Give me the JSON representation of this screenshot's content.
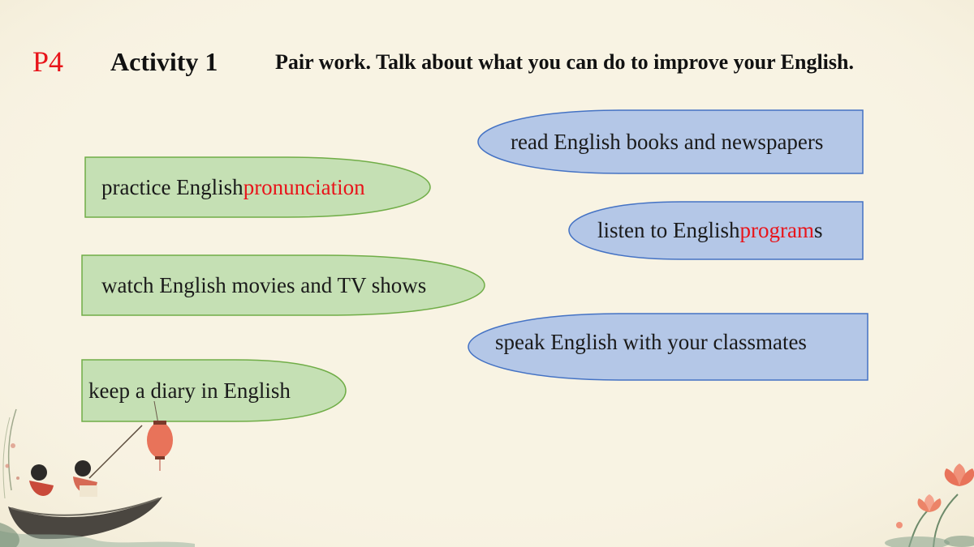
{
  "header": {
    "page_label": "P4",
    "activity_title": "Activity 1",
    "instruction": "Pair work. Talk about what you can do to improve your English."
  },
  "left_bubbles": [
    {
      "before": "practice English ",
      "highlight": "pronunciation",
      "after": ""
    },
    {
      "text": "watch English movies and TV shows"
    },
    {
      "text": "keep a diary in English"
    }
  ],
  "right_bubbles": [
    {
      "text": "read English books and newspapers"
    },
    {
      "before": "listen to English ",
      "highlight": "program",
      "after": "s"
    },
    {
      "text": "speak English with your classmates"
    }
  ],
  "colors": {
    "background": "#f8f3e3",
    "green_fill": "#c5e0b4",
    "green_border": "#70ad47",
    "blue_fill": "#b4c7e7",
    "blue_border": "#4472c4",
    "highlight_red": "#e8141a"
  }
}
